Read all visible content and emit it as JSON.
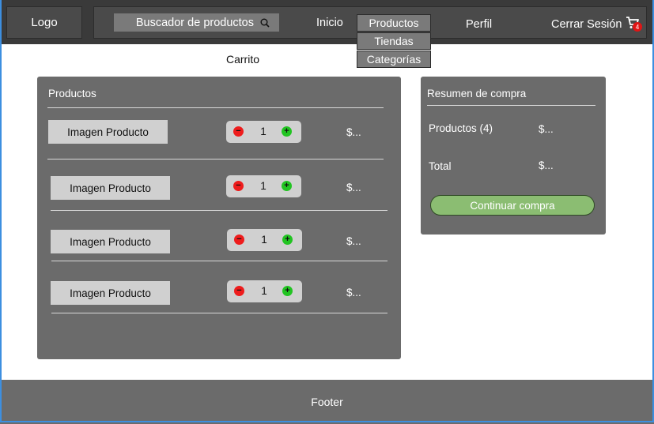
{
  "header": {
    "logo": "Logo",
    "search": {
      "label": "Buscador de productos"
    },
    "nav": {
      "inicio": "Inicio",
      "perfil": "Perfil",
      "cerrar_sesion": "Cerrar Sesión"
    },
    "dropdown": [
      "Productos",
      "Tiendas",
      "Categorías"
    ],
    "cart_badge": "4"
  },
  "page": {
    "title": "Carrito"
  },
  "products_panel": {
    "title": "Productos",
    "items": [
      {
        "image": "Imagen Producto",
        "qty": "1",
        "price": "$..."
      },
      {
        "image": "Imagen Producto",
        "qty": "1",
        "price": "$..."
      },
      {
        "image": "Imagen Producto",
        "qty": "1",
        "price": "$..."
      },
      {
        "image": "Imagen Producto",
        "qty": "1",
        "price": "$..."
      }
    ]
  },
  "summary": {
    "title": "Resumen de compra",
    "products_label": "Productos (4)",
    "products_value": "$...",
    "total_label": "Total",
    "total_value": "$...",
    "continue": "Continuar compra"
  },
  "footer": {
    "text": "Footer"
  },
  "colors": {
    "accent_green": "#8bbd72",
    "minus_red": "#ee1c1c",
    "plus_green": "#22c422",
    "badge_red": "#e01515"
  }
}
